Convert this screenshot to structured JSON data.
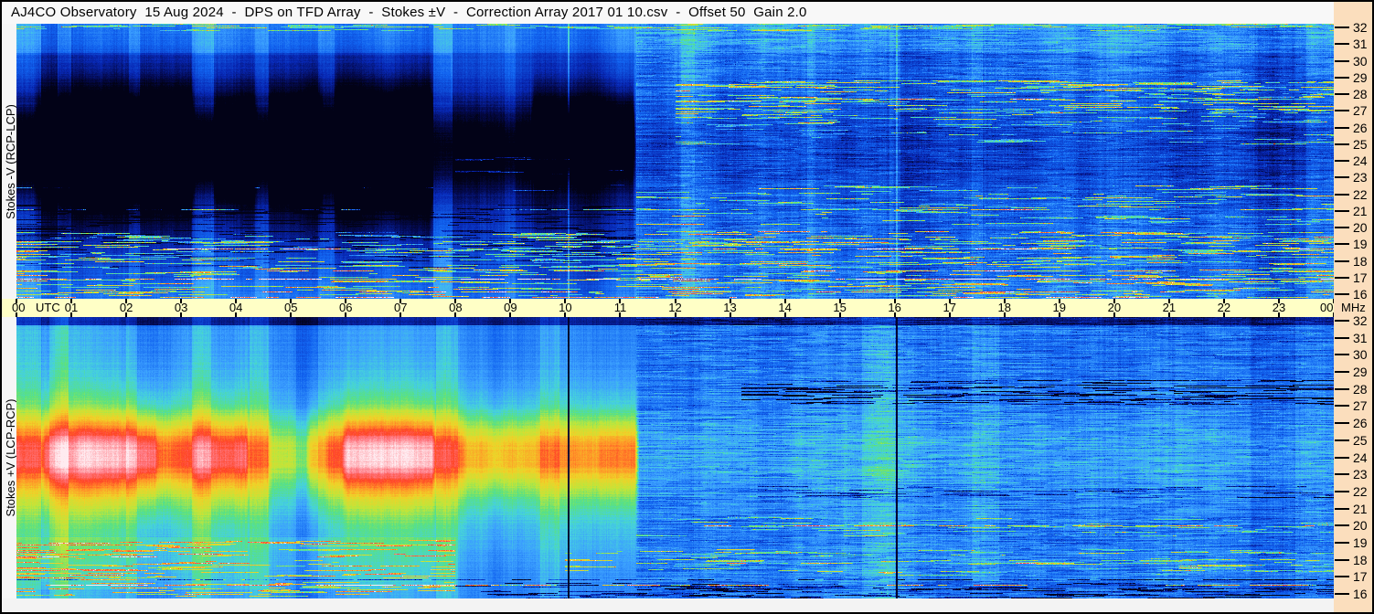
{
  "title": {
    "text": "AJ4CO Observatory  15 Aug 2024  -  DPS on TFD Array  -  Stokes ±V  -  Correction Array 2017 01 10.csv  -  Offset 50  Gain 2.0"
  },
  "colors": {
    "window_bg": "#f6f6f6",
    "time_axis_bg": "#ffffc6",
    "freq_axis_bg": "#fbdebd",
    "border": "#000000"
  },
  "time_axis": {
    "unit": "UTC",
    "labels": [
      "00",
      "01",
      "02",
      "03",
      "04",
      "05",
      "06",
      "07",
      "08",
      "09",
      "10",
      "11",
      "12",
      "13",
      "14",
      "15",
      "16",
      "17",
      "18",
      "19",
      "20",
      "21",
      "22",
      "23",
      "00"
    ]
  },
  "freq_axis": {
    "unit": "MHz",
    "ticks": [
      32,
      31,
      30,
      29,
      28,
      27,
      26,
      25,
      24,
      23,
      22,
      21,
      20,
      19,
      18,
      17,
      16
    ]
  },
  "chart_data": {
    "type": "heatmap",
    "title": "Dual dynamic spectrum (24-hour radio spectrogram), Stokes -V and +V",
    "x": {
      "label": "UTC",
      "min": 0,
      "max": 24,
      "tick_labels": [
        "00",
        "01",
        "02",
        "03",
        "04",
        "05",
        "06",
        "07",
        "08",
        "09",
        "10",
        "11",
        "12",
        "13",
        "14",
        "15",
        "16",
        "17",
        "18",
        "19",
        "20",
        "21",
        "22",
        "23",
        "00"
      ]
    },
    "y": {
      "label": "MHz",
      "min": 16,
      "max": 32,
      "ticks": [
        32,
        31,
        30,
        29,
        28,
        27,
        26,
        25,
        24,
        23,
        22,
        21,
        20,
        19,
        18,
        17,
        16
      ]
    },
    "colormap": {
      "stops": [
        [
          0.0,
          2,
          2,
          20
        ],
        [
          0.08,
          4,
          10,
          80
        ],
        [
          0.18,
          8,
          40,
          180
        ],
        [
          0.3,
          18,
          100,
          240
        ],
        [
          0.4,
          60,
          160,
          255
        ],
        [
          0.48,
          70,
          210,
          220
        ],
        [
          0.56,
          90,
          225,
          130
        ],
        [
          0.65,
          190,
          230,
          60
        ],
        [
          0.74,
          240,
          210,
          40
        ],
        [
          0.82,
          255,
          150,
          40
        ],
        [
          0.9,
          255,
          70,
          40
        ],
        [
          0.98,
          255,
          120,
          130
        ],
        [
          1.08,
          255,
          235,
          240
        ]
      ]
    },
    "panels": [
      {
        "name": "Stokes -V (RCP-LCP)",
        "polarity": "-V",
        "seed": 1337,
        "base": 0.31,
        "noise": [
          0.03,
          0.055
        ],
        "noise_split": 11.27,
        "band": {
          "center": 24.8,
          "width": 2.6,
          "glow_center": 24.0,
          "glow_width": 5.2,
          "segments": [
            [
              0,
              0.35,
              -0.55
            ],
            [
              0.35,
              0.8,
              -0.75
            ],
            [
              0.8,
              1.05,
              -0.85
            ],
            [
              1.05,
              2.1,
              -0.93
            ],
            [
              2.1,
              2.25,
              -0.8
            ],
            [
              2.25,
              3.2,
              -0.93
            ],
            [
              3.2,
              3.6,
              -0.55
            ],
            [
              3.6,
              4.35,
              -0.75
            ],
            [
              4.35,
              4.6,
              -0.5
            ],
            [
              4.6,
              5.25,
              -0.78
            ],
            [
              5.25,
              5.55,
              -0.9
            ],
            [
              5.55,
              5.8,
              -0.6
            ],
            [
              5.8,
              7.55,
              -0.95
            ],
            [
              7.55,
              7.95,
              -0.4
            ],
            [
              7.95,
              9.4,
              -0.38
            ],
            [
              9.4,
              11.25,
              -0.62,
              25.4,
              2.3
            ],
            [
              11.25,
              24,
              -0.1
            ]
          ]
        },
        "regions": [
          {
            "t": [
              0,
              24
            ],
            "f": [
              30.3,
              32
            ],
            "dv": 0.06
          },
          {
            "t": [
              0,
              7.9
            ],
            "f": [
              16,
              19.5
            ],
            "dv": 0.03
          },
          {
            "t": [
              0,
              7.9
            ],
            "f": [
              27.5,
              30.2
            ],
            "dv": -0.03
          },
          {
            "t": [
              7.95,
              11.25
            ],
            "f": [
              16,
              32
            ],
            "dv": -0.015
          },
          {
            "t": [
              11.25,
              24
            ],
            "f": [
              16,
              32
            ],
            "dv": 0.025
          },
          {
            "t": [
              0,
              24
            ],
            "f": [
              16,
              17
            ],
            "dv": 0.02
          }
        ],
        "vertical_bands": [
          [
            0,
            0.45,
            0.1
          ],
          [
            0.75,
            1.0,
            0.08
          ],
          [
            2.05,
            2.25,
            0.06
          ],
          [
            3.2,
            3.6,
            0.07
          ],
          [
            4.35,
            4.6,
            0.06
          ],
          [
            5.5,
            5.8,
            0.05
          ],
          [
            7.6,
            7.95,
            0.08
          ],
          [
            8.9,
            9.1,
            0.04
          ],
          [
            12.1,
            12.35,
            0.05
          ],
          [
            14.4,
            14.55,
            0.04
          ],
          [
            15.9,
            16.1,
            0.05
          ],
          [
            17.4,
            17.6,
            0.04
          ],
          [
            22.55,
            23.3,
            -0.03
          ],
          [
            23.5,
            24,
            0.06
          ]
        ],
        "vlines": [
          {
            "t": 10.04,
            "mode": "add",
            "dv": 0.16,
            "w": 2
          },
          {
            "t": 16.02,
            "mode": "add",
            "dv": 0.13,
            "w": 2
          }
        ],
        "speckle_bands": [
          {
            "f": [
              31.6,
              32
            ],
            "t": [
              0,
              24
            ],
            "amp": 0.18,
            "d": 0.35
          },
          {
            "f": [
              26.2,
              28.7
            ],
            "t": [
              12,
              24
            ],
            "amp": 0.3,
            "d": 0.3
          },
          {
            "f": [
              25,
              26.2
            ],
            "t": [
              12,
              24
            ],
            "amp": 0.22,
            "d": 0.12
          },
          {
            "f": [
              20.3,
              22.6
            ],
            "t": [
              11.3,
              24
            ],
            "amp": 0.28,
            "d": 0.18
          },
          {
            "f": [
              16.1,
              19.9
            ],
            "t": [
              0,
              24
            ],
            "amp": 0.32,
            "d": 0.25
          },
          {
            "f": [
              17.8,
              21.5
            ],
            "t": [
              0,
              11.3
            ],
            "amp": -0.12,
            "d": 0.3
          },
          {
            "f": [
              22,
              24.5
            ],
            "t": [
              8,
              11.3
            ],
            "amp": 0.15,
            "d": 0.06
          },
          {
            "f": [
              16,
              32
            ],
            "t": [
              11.3,
              24
            ],
            "amp": 0.05,
            "d": 0.5
          },
          {
            "f": [
              16,
              32
            ],
            "t": [
              11.3,
              24
            ],
            "amp": -0.05,
            "d": 0.5
          }
        ],
        "lines": [
          {
            "f": 17.15,
            "t": [
              0,
              24
            ],
            "amp": 0.72,
            "d": 0.85
          },
          {
            "f": 17.6,
            "t": [
              0,
              24
            ],
            "amp": 0.45,
            "d": 0.6
          },
          {
            "f": 18.9,
            "t": [
              0,
              24
            ],
            "amp": 0.5,
            "d": 0.7
          },
          {
            "f": 19.9,
            "t": [
              11.3,
              24
            ],
            "amp": 0.42,
            "d": 0.6
          },
          {
            "f": 21.2,
            "t": [
              0,
              24
            ],
            "amp": 0.3,
            "d": 0.6
          },
          {
            "f": 22.45,
            "t": [
              0,
              7.6
            ],
            "amp": 0.35,
            "d": 0.7
          },
          {
            "f": 27.6,
            "t": [
              13,
              24
            ],
            "amp": 0.35,
            "d": 0.5
          },
          {
            "f": 26.8,
            "t": [
              14,
              24
            ],
            "amp": 0.3,
            "d": 0.45
          },
          {
            "f": 16.4,
            "t": [
              0,
              24
            ],
            "amp": 0.45,
            "d": 0.5
          },
          {
            "f": 16.1,
            "t": [
              0,
              24
            ],
            "amp": 0.5,
            "d": 0.55
          }
        ]
      },
      {
        "name": "Stokes +V (LCP-RCP)",
        "polarity": "+V",
        "seed": 4242,
        "base": 0.335,
        "noise": [
          0.028,
          0.045
        ],
        "noise_split": 11.3,
        "band": {
          "center": 24.2,
          "width": 2.1,
          "glow_center": 23.2,
          "glow_width": 5.0,
          "segments": [
            [
              0,
              0.5,
              0.52
            ],
            [
              0.5,
              1.1,
              0.62
            ],
            [
              1.1,
              2.55,
              0.68
            ],
            [
              2.55,
              3.25,
              0.55
            ],
            [
              3.25,
              4.2,
              0.6
            ],
            [
              4.2,
              4.6,
              0.46
            ],
            [
              4.6,
              5.3,
              0.33
            ],
            [
              5.3,
              5.65,
              0.48
            ],
            [
              5.65,
              5.95,
              0.55
            ],
            [
              5.95,
              7.6,
              0.7
            ],
            [
              7.6,
              8.15,
              0.52
            ],
            [
              8.15,
              9.5,
              0.46
            ],
            [
              9.5,
              10.6,
              0.49
            ],
            [
              10.6,
              11.3,
              0.53
            ],
            [
              11.3,
              24,
              0.09
            ]
          ]
        },
        "regions": [
          {
            "t": [
              0,
              24
            ],
            "f": [
              31.55,
              32
            ],
            "dv": -0.2
          },
          {
            "t": [
              0,
              7.9
            ],
            "f": [
              16,
              31.5
            ],
            "dv": 0.035
          },
          {
            "t": [
              11.3,
              24
            ],
            "f": [
              16,
              32
            ],
            "dv": -0.01
          },
          {
            "t": [
              0,
              8
            ],
            "f": [
              16.5,
              19.5
            ],
            "dv": 0.04
          },
          {
            "t": [
              11.3,
              24
            ],
            "f": [
              17,
              18.8
            ],
            "dv": 0.02
          }
        ],
        "vertical_bands": [
          [
            0,
            0.45,
            0.08
          ],
          [
            0.6,
            0.95,
            0.07
          ],
          [
            2,
            2.2,
            0.05
          ],
          [
            3.2,
            3.55,
            0.06
          ],
          [
            4.25,
            4.6,
            0.05
          ],
          [
            7.65,
            8.05,
            0.07
          ],
          [
            9.55,
            9.9,
            0.05
          ],
          [
            15.4,
            16,
            0.05
          ],
          [
            17.4,
            17.9,
            0.04
          ],
          [
            5.1,
            5.5,
            -0.05
          ],
          [
            22.5,
            23.3,
            -0.04
          ]
        ],
        "vlines": [
          {
            "t": 10.04,
            "mode": "set",
            "dv": 0.04,
            "w": 2
          },
          {
            "t": 16.02,
            "mode": "set",
            "dv": 0.04,
            "w": 2
          }
        ],
        "speckle_bands": [
          {
            "f": [
              27,
              28.4
            ],
            "t": [
              13.2,
              24
            ],
            "amp": -0.3,
            "d": 0.4
          },
          {
            "f": [
              21.7,
              22.4
            ],
            "t": [
              13.5,
              24
            ],
            "amp": -0.18,
            "d": 0.25
          },
          {
            "f": [
              16,
              16.9
            ],
            "t": [
              8,
              24
            ],
            "amp": -0.22,
            "d": 0.35
          },
          {
            "f": [
              17.3,
              18.8
            ],
            "t": [
              10,
              24
            ],
            "amp": 0.22,
            "d": 0.2
          },
          {
            "f": [
              16.1,
              19.4
            ],
            "t": [
              0,
              8
            ],
            "amp": 0.28,
            "d": 0.25
          },
          {
            "f": [
              19.5,
              20.6
            ],
            "t": [
              11.3,
              24
            ],
            "amp": 0.18,
            "d": 0.12
          },
          {
            "f": [
              16,
              32
            ],
            "t": [
              11.3,
              24
            ],
            "amp": 0.05,
            "d": 0.5
          },
          {
            "f": [
              16,
              32
            ],
            "t": [
              11.3,
              24
            ],
            "amp": -0.06,
            "d": 0.5
          }
        ],
        "lines": [
          {
            "f": 17.05,
            "t": [
              0,
              24
            ],
            "amp": -0.3,
            "d": 0.9
          },
          {
            "f": 16.75,
            "t": [
              0,
              24
            ],
            "amp": 0.45,
            "d": 0.55
          },
          {
            "f": 18.35,
            "t": [
              0,
              7
            ],
            "amp": 0.4,
            "d": 0.6
          },
          {
            "f": 20.15,
            "t": [
              11.3,
              24
            ],
            "amp": 0.42,
            "d": 0.7
          },
          {
            "f": 18,
            "t": [
              11.3,
              24
            ],
            "amp": 0.3,
            "d": 0.5
          },
          {
            "f": 28,
            "t": [
              13.2,
              24
            ],
            "amp": -0.35,
            "d": 0.6
          }
        ]
      }
    ]
  }
}
